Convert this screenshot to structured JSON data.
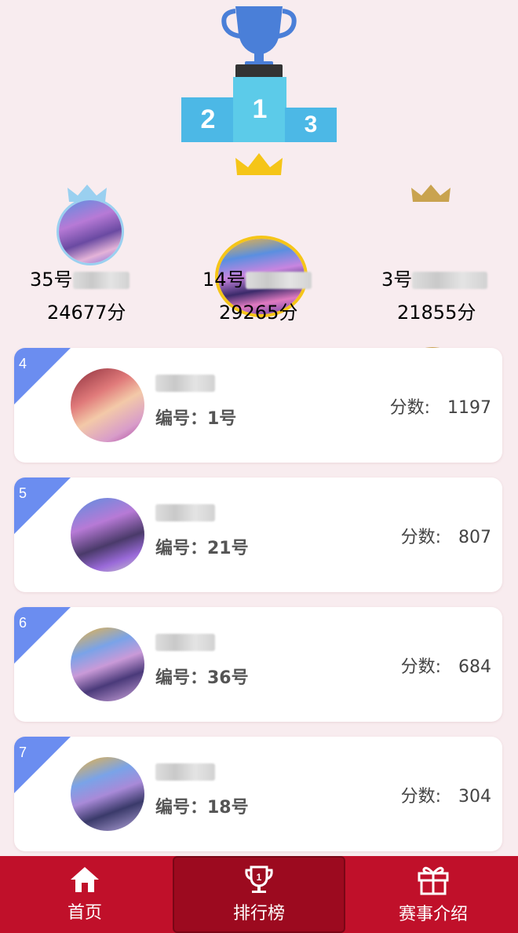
{
  "podium": {
    "first": "1",
    "second": "2",
    "third": "3"
  },
  "top3": [
    {
      "place": 2,
      "name": "35号",
      "score": "24677分",
      "crown_color": "#9ad0f0"
    },
    {
      "place": 1,
      "name": "14号",
      "score": "29265分",
      "crown_color": "#f5c518"
    },
    {
      "place": 3,
      "name": "3号",
      "score": "21855分",
      "crown_color": "#c9a34f"
    }
  ],
  "ranking": [
    {
      "rank": "4",
      "id_label": "编号：1号",
      "score_label": "分数:",
      "score": "1197"
    },
    {
      "rank": "5",
      "id_label": "编号：21号",
      "score_label": "分数:",
      "score": "807"
    },
    {
      "rank": "6",
      "id_label": "编号：36号",
      "score_label": "分数:",
      "score": "684"
    },
    {
      "rank": "7",
      "id_label": "编号：18号",
      "score_label": "分数:",
      "score": "304"
    }
  ],
  "nav": {
    "home": {
      "label": "首页",
      "icon": "home-icon"
    },
    "ranking": {
      "label": "排行榜",
      "icon": "trophy-icon"
    },
    "about": {
      "label": "赛事介绍",
      "icon": "gift-icon"
    }
  },
  "colors": {
    "nav_bg": "#c0102a",
    "podium": "#4cb8e6",
    "rank_badge": "#6b8df0",
    "page_bg": "#f8ecef"
  }
}
